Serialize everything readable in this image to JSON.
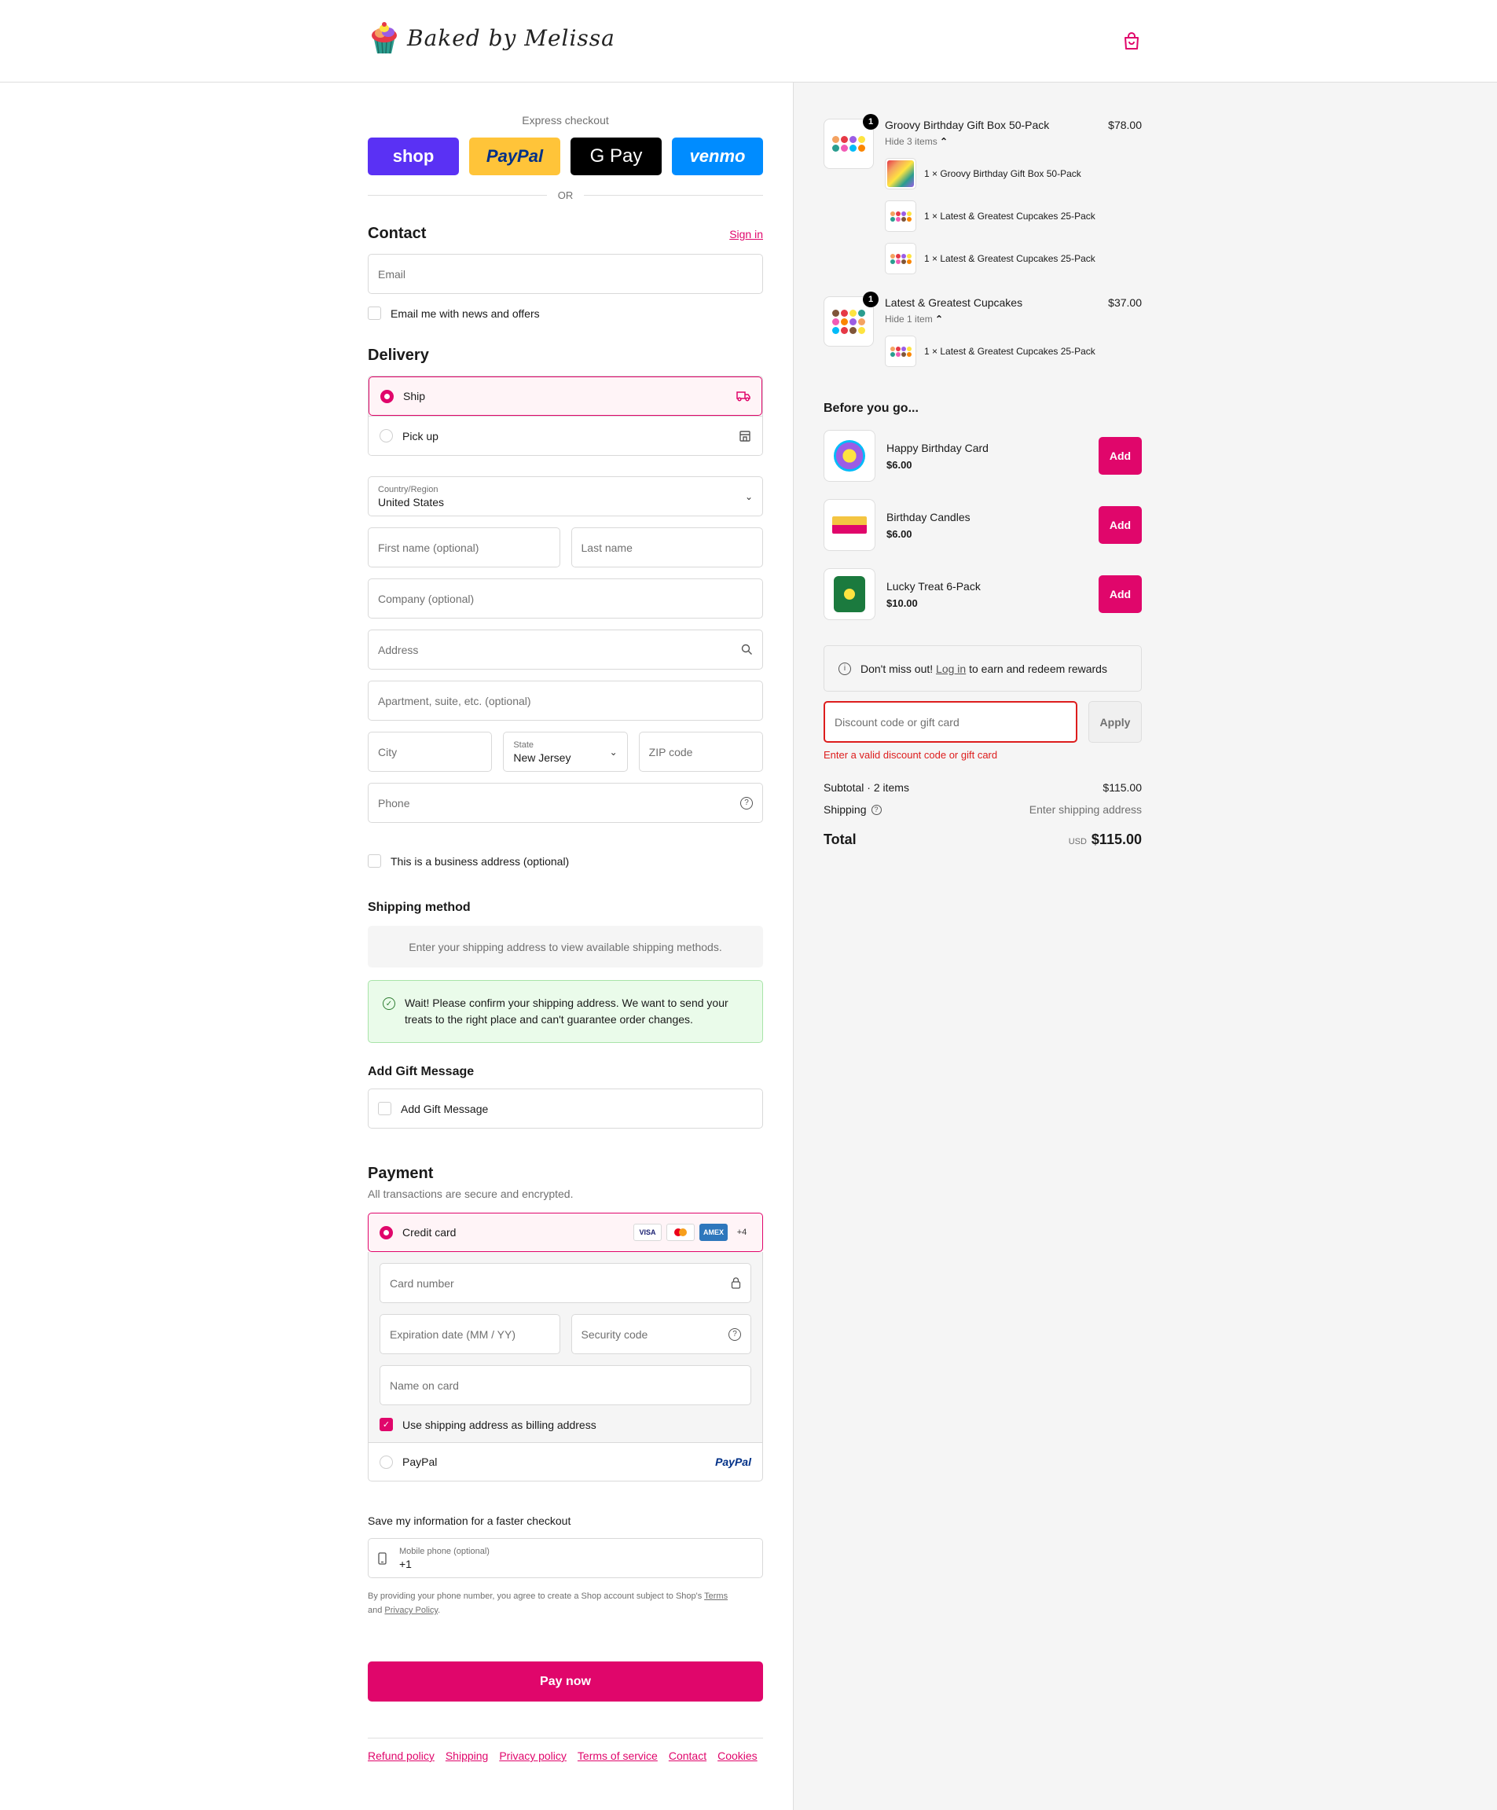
{
  "header": {
    "brand_name": "Baked by Melissa",
    "cart_icon": "shopping-bag-icon"
  },
  "express": {
    "label": "Express checkout",
    "buttons": [
      "shop",
      "PayPal",
      "G Pay",
      "venmo"
    ],
    "or": "OR"
  },
  "contact": {
    "title": "Contact",
    "sign_in": "Sign in",
    "email_placeholder": "Email",
    "news_checkbox": "Email me with news and offers"
  },
  "delivery": {
    "title": "Delivery",
    "options": [
      {
        "label": "Ship",
        "icon": "truck-icon",
        "selected": true
      },
      {
        "label": "Pick up",
        "icon": "store-icon",
        "selected": false
      }
    ],
    "country_label": "Country/Region",
    "country_value": "United States",
    "first_name": "First name (optional)",
    "last_name": "Last name",
    "company": "Company (optional)",
    "address": "Address",
    "apartment": "Apartment, suite, etc. (optional)",
    "city": "City",
    "state_label": "State",
    "state_value": "New Jersey",
    "zip": "ZIP code",
    "phone": "Phone",
    "business_checkbox": "This is a business address (optional)"
  },
  "shipping_method": {
    "title": "Shipping method",
    "message": "Enter your shipping address to view available shipping methods."
  },
  "notice": {
    "text": "Wait! Please confirm your shipping address. We want to send your treats to the right place and can't guarantee order changes."
  },
  "gift": {
    "title": "Add Gift Message",
    "checkbox": "Add Gift Message"
  },
  "payment": {
    "title": "Payment",
    "subtitle": "All transactions are secure and encrypted.",
    "credit_card": "Credit card",
    "card_brands": [
      "VISA",
      "MC",
      "AMEX"
    ],
    "more_brands": "+4",
    "card_number": "Card number",
    "expiration": "Expiration date (MM / YY)",
    "security": "Security code",
    "name_on_card": "Name on card",
    "billing_checkbox": "Use shipping address as billing address",
    "paypal": "PayPal",
    "paypal_logo": "PayPal"
  },
  "save_info": {
    "title": "Save my information for a faster checkout",
    "phone_label": "Mobile phone (optional)",
    "phone_value": "+1",
    "fine_print_1": "By providing your phone number, you agree to create a Shop account subject to Shop's ",
    "terms": "Terms",
    "fine_print_2": "and ",
    "privacy": "Privacy Policy",
    "fine_print_3": "."
  },
  "pay_now": "Pay now",
  "footer_links": [
    "Refund policy",
    "Shipping",
    "Privacy policy",
    "Terms of service",
    "Contact",
    "Cookies"
  ],
  "order": {
    "items": [
      {
        "name": "Groovy Birthday Gift Box 50-Pack",
        "price": "$78.00",
        "qty": "1",
        "hide": "Hide 3 items",
        "sub": [
          "1 × Groovy Birthday Gift Box 50-Pack",
          "1 × Latest & Greatest Cupcakes 25-Pack",
          "1 × Latest & Greatest Cupcakes 25-Pack"
        ]
      },
      {
        "name": "Latest & Greatest Cupcakes",
        "price": "$37.00",
        "qty": "1",
        "hide": "Hide 1 item",
        "sub": [
          "1 × Latest & Greatest Cupcakes 25-Pack"
        ]
      }
    ],
    "before_title": "Before you go...",
    "upsells": [
      {
        "name": "Happy Birthday Card",
        "price": "$6.00",
        "button": "Add"
      },
      {
        "name": "Birthday Candles",
        "price": "$6.00",
        "button": "Add"
      },
      {
        "name": "Lucky Treat 6-Pack",
        "price": "$10.00",
        "button": "Add"
      }
    ],
    "rewards_pre": "Don't miss out! ",
    "rewards_link": "Log in",
    "rewards_post": " to earn and redeem rewards",
    "discount_placeholder": "Discount code or gift card",
    "apply": "Apply",
    "discount_error": "Enter a valid discount code or gift card",
    "subtotal_label": "Subtotal · 2 items",
    "subtotal_value": "$115.00",
    "shipping_label": "Shipping",
    "shipping_value": "Enter shipping address",
    "total_label": "Total",
    "currency": "USD",
    "total_value": "$115.00"
  },
  "colors": {
    "accent": "#e0066b",
    "error": "#dd1d1d",
    "sidebar_bg": "#f5f5f5"
  }
}
